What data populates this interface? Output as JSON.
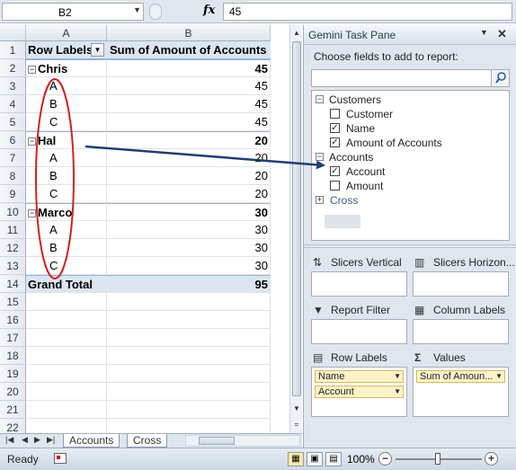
{
  "formula_bar": {
    "cell_ref": "B2",
    "fx": "fx",
    "value": "45"
  },
  "grid": {
    "columns": [
      "A",
      "B"
    ],
    "header": {
      "row_labels": "Row Labels",
      "value_header": "Sum of Amount of Accounts"
    },
    "rows": [
      {
        "num": "1"
      },
      {
        "num": "2",
        "label": "Chris",
        "value": "45"
      },
      {
        "num": "3",
        "label": "A",
        "value": "45"
      },
      {
        "num": "4",
        "label": "B",
        "value": "45"
      },
      {
        "num": "5",
        "label": "C",
        "value": "45"
      },
      {
        "num": "6",
        "label": "Hal",
        "value": "20"
      },
      {
        "num": "7",
        "label": "A",
        "value": "20"
      },
      {
        "num": "8",
        "label": "B",
        "value": "20"
      },
      {
        "num": "9",
        "label": "C",
        "value": "20"
      },
      {
        "num": "10",
        "label": "Marco",
        "value": "30"
      },
      {
        "num": "11",
        "label": "A",
        "value": "30"
      },
      {
        "num": "12",
        "label": "B",
        "value": "30"
      },
      {
        "num": "13",
        "label": "C",
        "value": "30"
      },
      {
        "num": "14",
        "label": "Grand Total",
        "value": "95"
      },
      {
        "num": "15"
      },
      {
        "num": "16"
      },
      {
        "num": "17"
      },
      {
        "num": "18"
      },
      {
        "num": "19"
      },
      {
        "num": "20"
      },
      {
        "num": "21"
      },
      {
        "num": "22"
      }
    ]
  },
  "sheet_tabs": [
    "Accounts",
    "Cross"
  ],
  "status": {
    "text": "Ready",
    "zoom": "100%"
  },
  "task_pane": {
    "title": "Gemini Task Pane",
    "choose_label": "Choose fields to add to report:",
    "search_value": "",
    "tables": [
      {
        "name": "Customers",
        "fields": [
          {
            "name": "Customer",
            "checked": false
          },
          {
            "name": "Name",
            "checked": true
          },
          {
            "name": "Amount of Accounts",
            "checked": true
          }
        ]
      },
      {
        "name": "Accounts",
        "fields": [
          {
            "name": "Account",
            "checked": true
          },
          {
            "name": "Amount",
            "checked": false
          }
        ]
      },
      {
        "name": "Cross",
        "fields": []
      }
    ],
    "areas": {
      "slicers_vertical": "Slicers Vertical",
      "slicers_horizontal": "Slicers Horizon...",
      "report_filter": "Report Filter",
      "column_labels": "Column Labels",
      "row_labels": "Row Labels",
      "values": "Values"
    },
    "row_label_fields": [
      "Name",
      "Account"
    ],
    "value_fields": [
      "Sum of Amoun..."
    ]
  },
  "colors": {
    "pivot_header": "#dce6f1",
    "annotation_ellipse": "#d42020",
    "annotation_arrow": "#1f3f73",
    "chip": "#fff2c8"
  }
}
